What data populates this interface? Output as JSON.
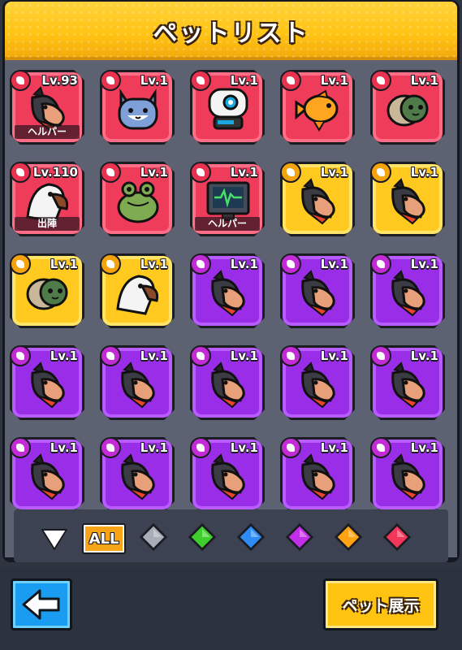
{
  "header": {
    "title": "ペットリスト"
  },
  "pets": [
    {
      "rarity": "red",
      "level": "Lv.93",
      "pet_icon": "dog-icon",
      "tag": "ヘルパー"
    },
    {
      "rarity": "red",
      "level": "Lv.1",
      "pet_icon": "cat-icon",
      "tag": ""
    },
    {
      "rarity": "red",
      "level": "Lv.1",
      "pet_icon": "robot-icon",
      "tag": ""
    },
    {
      "rarity": "red",
      "level": "Lv.1",
      "pet_icon": "goldfish-icon",
      "tag": ""
    },
    {
      "rarity": "red",
      "level": "Lv.1",
      "pet_icon": "turtle-icon",
      "tag": ""
    },
    {
      "rarity": "red",
      "level": "Lv.110",
      "pet_icon": "eagle-icon",
      "tag": "出陣"
    },
    {
      "rarity": "red",
      "level": "Lv.1",
      "pet_icon": "frog-icon",
      "tag": ""
    },
    {
      "rarity": "red",
      "level": "Lv.1",
      "pet_icon": "monitor-icon",
      "tag": "ヘルパー"
    },
    {
      "rarity": "yellow",
      "level": "Lv.1",
      "pet_icon": "dog-icon",
      "tag": ""
    },
    {
      "rarity": "yellow",
      "level": "Lv.1",
      "pet_icon": "dog-icon",
      "tag": ""
    },
    {
      "rarity": "yellow",
      "level": "Lv.1",
      "pet_icon": "turtle-icon",
      "tag": ""
    },
    {
      "rarity": "yellow",
      "level": "Lv.1",
      "pet_icon": "eagle-icon",
      "tag": ""
    },
    {
      "rarity": "purple",
      "level": "Lv.1",
      "pet_icon": "dog-icon",
      "tag": ""
    },
    {
      "rarity": "purple",
      "level": "Lv.1",
      "pet_icon": "dog-icon",
      "tag": ""
    },
    {
      "rarity": "purple",
      "level": "Lv.1",
      "pet_icon": "dog-icon",
      "tag": ""
    },
    {
      "rarity": "purple",
      "level": "Lv.1",
      "pet_icon": "dog-icon",
      "tag": ""
    },
    {
      "rarity": "purple",
      "level": "Lv.1",
      "pet_icon": "dog-icon",
      "tag": ""
    },
    {
      "rarity": "purple",
      "level": "Lv.1",
      "pet_icon": "dog-icon",
      "tag": ""
    },
    {
      "rarity": "purple",
      "level": "Lv.1",
      "pet_icon": "dog-icon",
      "tag": ""
    },
    {
      "rarity": "purple",
      "level": "Lv.1",
      "pet_icon": "dog-icon",
      "tag": ""
    },
    {
      "rarity": "purple",
      "level": "Lv.1",
      "pet_icon": "dog-icon",
      "tag": ""
    },
    {
      "rarity": "purple",
      "level": "Lv.1",
      "pet_icon": "dog-icon",
      "tag": ""
    },
    {
      "rarity": "purple",
      "level": "Lv.1",
      "pet_icon": "dog-icon",
      "tag": ""
    },
    {
      "rarity": "purple",
      "level": "Lv.1",
      "pet_icon": "dog-icon",
      "tag": ""
    },
    {
      "rarity": "purple",
      "level": "Lv.1",
      "pet_icon": "dog-icon",
      "tag": ""
    }
  ],
  "filters": {
    "all_label": "ALL",
    "gems": [
      {
        "name": "gray",
        "color": "#a9adb8"
      },
      {
        "name": "green",
        "color": "#3fcf2c"
      },
      {
        "name": "blue",
        "color": "#2d8cf5"
      },
      {
        "name": "purple",
        "color": "#c12fe8"
      },
      {
        "name": "orange",
        "color": "#ffa315"
      },
      {
        "name": "red",
        "color": "#f4365a"
      }
    ]
  },
  "footer": {
    "show_label": "ペット展示"
  },
  "colors": {
    "accent": "#ffc412",
    "back_button": "#1a9cf0"
  }
}
